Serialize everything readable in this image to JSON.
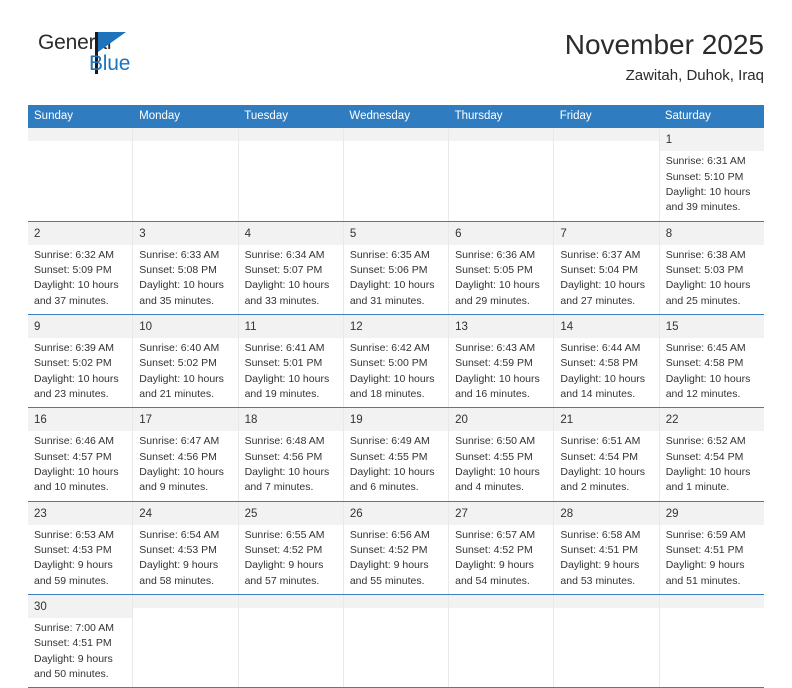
{
  "brand": {
    "name_top": "General",
    "name_bottom": "Blue",
    "accent_color": "#1d73bc"
  },
  "header": {
    "title": "November 2025",
    "subtitle": "Zawitah, Duhok, Iraq"
  },
  "theme": {
    "header_row_bg": "#2f7cc0",
    "header_row_text": "#ffffff",
    "day_band_bg": "#f2f2f2",
    "row_divider": "#3d7ebf",
    "cell_divider": "#e9e9e9",
    "text": "#333333"
  },
  "weekdays": [
    "Sunday",
    "Monday",
    "Tuesday",
    "Wednesday",
    "Thursday",
    "Friday",
    "Saturday"
  ],
  "labels": {
    "sunrise_prefix": "Sunrise:",
    "sunset_prefix": "Sunset:",
    "daylight_prefix": "Daylight:"
  },
  "weeks": [
    [
      {
        "empty": true
      },
      {
        "empty": true
      },
      {
        "empty": true
      },
      {
        "empty": true
      },
      {
        "empty": true
      },
      {
        "empty": true
      },
      {
        "day": "1",
        "sunrise": "Sunrise: 6:31 AM",
        "sunset": "Sunset: 5:10 PM",
        "daylight_line1": "Daylight: 10 hours",
        "daylight_line2": "and 39 minutes."
      }
    ],
    [
      {
        "day": "2",
        "sunrise": "Sunrise: 6:32 AM",
        "sunset": "Sunset: 5:09 PM",
        "daylight_line1": "Daylight: 10 hours",
        "daylight_line2": "and 37 minutes."
      },
      {
        "day": "3",
        "sunrise": "Sunrise: 6:33 AM",
        "sunset": "Sunset: 5:08 PM",
        "daylight_line1": "Daylight: 10 hours",
        "daylight_line2": "and 35 minutes."
      },
      {
        "day": "4",
        "sunrise": "Sunrise: 6:34 AM",
        "sunset": "Sunset: 5:07 PM",
        "daylight_line1": "Daylight: 10 hours",
        "daylight_line2": "and 33 minutes."
      },
      {
        "day": "5",
        "sunrise": "Sunrise: 6:35 AM",
        "sunset": "Sunset: 5:06 PM",
        "daylight_line1": "Daylight: 10 hours",
        "daylight_line2": "and 31 minutes."
      },
      {
        "day": "6",
        "sunrise": "Sunrise: 6:36 AM",
        "sunset": "Sunset: 5:05 PM",
        "daylight_line1": "Daylight: 10 hours",
        "daylight_line2": "and 29 minutes."
      },
      {
        "day": "7",
        "sunrise": "Sunrise: 6:37 AM",
        "sunset": "Sunset: 5:04 PM",
        "daylight_line1": "Daylight: 10 hours",
        "daylight_line2": "and 27 minutes."
      },
      {
        "day": "8",
        "sunrise": "Sunrise: 6:38 AM",
        "sunset": "Sunset: 5:03 PM",
        "daylight_line1": "Daylight: 10 hours",
        "daylight_line2": "and 25 minutes."
      }
    ],
    [
      {
        "day": "9",
        "sunrise": "Sunrise: 6:39 AM",
        "sunset": "Sunset: 5:02 PM",
        "daylight_line1": "Daylight: 10 hours",
        "daylight_line2": "and 23 minutes."
      },
      {
        "day": "10",
        "sunrise": "Sunrise: 6:40 AM",
        "sunset": "Sunset: 5:02 PM",
        "daylight_line1": "Daylight: 10 hours",
        "daylight_line2": "and 21 minutes."
      },
      {
        "day": "11",
        "sunrise": "Sunrise: 6:41 AM",
        "sunset": "Sunset: 5:01 PM",
        "daylight_line1": "Daylight: 10 hours",
        "daylight_line2": "and 19 minutes."
      },
      {
        "day": "12",
        "sunrise": "Sunrise: 6:42 AM",
        "sunset": "Sunset: 5:00 PM",
        "daylight_line1": "Daylight: 10 hours",
        "daylight_line2": "and 18 minutes."
      },
      {
        "day": "13",
        "sunrise": "Sunrise: 6:43 AM",
        "sunset": "Sunset: 4:59 PM",
        "daylight_line1": "Daylight: 10 hours",
        "daylight_line2": "and 16 minutes."
      },
      {
        "day": "14",
        "sunrise": "Sunrise: 6:44 AM",
        "sunset": "Sunset: 4:58 PM",
        "daylight_line1": "Daylight: 10 hours",
        "daylight_line2": "and 14 minutes."
      },
      {
        "day": "15",
        "sunrise": "Sunrise: 6:45 AM",
        "sunset": "Sunset: 4:58 PM",
        "daylight_line1": "Daylight: 10 hours",
        "daylight_line2": "and 12 minutes."
      }
    ],
    [
      {
        "day": "16",
        "sunrise": "Sunrise: 6:46 AM",
        "sunset": "Sunset: 4:57 PM",
        "daylight_line1": "Daylight: 10 hours",
        "daylight_line2": "and 10 minutes."
      },
      {
        "day": "17",
        "sunrise": "Sunrise: 6:47 AM",
        "sunset": "Sunset: 4:56 PM",
        "daylight_line1": "Daylight: 10 hours",
        "daylight_line2": "and 9 minutes."
      },
      {
        "day": "18",
        "sunrise": "Sunrise: 6:48 AM",
        "sunset": "Sunset: 4:56 PM",
        "daylight_line1": "Daylight: 10 hours",
        "daylight_line2": "and 7 minutes."
      },
      {
        "day": "19",
        "sunrise": "Sunrise: 6:49 AM",
        "sunset": "Sunset: 4:55 PM",
        "daylight_line1": "Daylight: 10 hours",
        "daylight_line2": "and 6 minutes."
      },
      {
        "day": "20",
        "sunrise": "Sunrise: 6:50 AM",
        "sunset": "Sunset: 4:55 PM",
        "daylight_line1": "Daylight: 10 hours",
        "daylight_line2": "and 4 minutes."
      },
      {
        "day": "21",
        "sunrise": "Sunrise: 6:51 AM",
        "sunset": "Sunset: 4:54 PM",
        "daylight_line1": "Daylight: 10 hours",
        "daylight_line2": "and 2 minutes."
      },
      {
        "day": "22",
        "sunrise": "Sunrise: 6:52 AM",
        "sunset": "Sunset: 4:54 PM",
        "daylight_line1": "Daylight: 10 hours",
        "daylight_line2": "and 1 minute."
      }
    ],
    [
      {
        "day": "23",
        "sunrise": "Sunrise: 6:53 AM",
        "sunset": "Sunset: 4:53 PM",
        "daylight_line1": "Daylight: 9 hours",
        "daylight_line2": "and 59 minutes."
      },
      {
        "day": "24",
        "sunrise": "Sunrise: 6:54 AM",
        "sunset": "Sunset: 4:53 PM",
        "daylight_line1": "Daylight: 9 hours",
        "daylight_line2": "and 58 minutes."
      },
      {
        "day": "25",
        "sunrise": "Sunrise: 6:55 AM",
        "sunset": "Sunset: 4:52 PM",
        "daylight_line1": "Daylight: 9 hours",
        "daylight_line2": "and 57 minutes."
      },
      {
        "day": "26",
        "sunrise": "Sunrise: 6:56 AM",
        "sunset": "Sunset: 4:52 PM",
        "daylight_line1": "Daylight: 9 hours",
        "daylight_line2": "and 55 minutes."
      },
      {
        "day": "27",
        "sunrise": "Sunrise: 6:57 AM",
        "sunset": "Sunset: 4:52 PM",
        "daylight_line1": "Daylight: 9 hours",
        "daylight_line2": "and 54 minutes."
      },
      {
        "day": "28",
        "sunrise": "Sunrise: 6:58 AM",
        "sunset": "Sunset: 4:51 PM",
        "daylight_line1": "Daylight: 9 hours",
        "daylight_line2": "and 53 minutes."
      },
      {
        "day": "29",
        "sunrise": "Sunrise: 6:59 AM",
        "sunset": "Sunset: 4:51 PM",
        "daylight_line1": "Daylight: 9 hours",
        "daylight_line2": "and 51 minutes."
      }
    ],
    [
      {
        "day": "30",
        "sunrise": "Sunrise: 7:00 AM",
        "sunset": "Sunset: 4:51 PM",
        "daylight_line1": "Daylight: 9 hours",
        "daylight_line2": "and 50 minutes."
      },
      {
        "empty": true
      },
      {
        "empty": true
      },
      {
        "empty": true
      },
      {
        "empty": true
      },
      {
        "empty": true
      },
      {
        "empty": true
      }
    ]
  ]
}
